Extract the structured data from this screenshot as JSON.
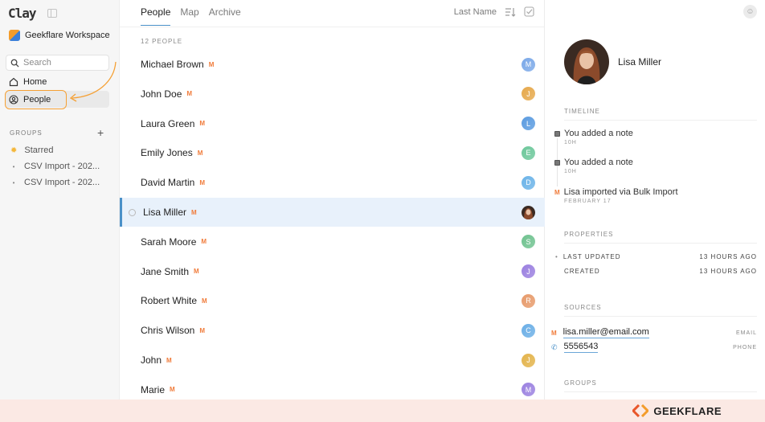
{
  "sidebar": {
    "logo": "Clay",
    "workspace": "Geekflare Workspace",
    "search_placeholder": "Search",
    "nav": {
      "home": "Home",
      "people": "People"
    },
    "groups_header": "GROUPS",
    "groups_add": "+",
    "groups": [
      {
        "label": "Starred"
      },
      {
        "label": "CSV Import - 202..."
      },
      {
        "label": "CSV Import - 202..."
      }
    ]
  },
  "list": {
    "tabs": [
      {
        "label": "People",
        "active": true
      },
      {
        "label": "Map",
        "active": false
      },
      {
        "label": "Archive",
        "active": false
      }
    ],
    "sort_label": "Last Name",
    "count_label": "12 PEOPLE",
    "badge": "M",
    "people": [
      {
        "name": "Michael Brown",
        "initial": "M",
        "selected": false
      },
      {
        "name": "John Doe",
        "initial": "J",
        "selected": false
      },
      {
        "name": "Laura Green",
        "initial": "L",
        "selected": false
      },
      {
        "name": "Emily Jones",
        "initial": "E",
        "selected": false
      },
      {
        "name": "David Martin",
        "initial": "D",
        "selected": false
      },
      {
        "name": "Lisa Miller",
        "initial": "",
        "selected": true
      },
      {
        "name": "Sarah Moore",
        "initial": "S",
        "selected": false
      },
      {
        "name": "Jane Smith",
        "initial": "J",
        "selected": false
      },
      {
        "name": "Robert White",
        "initial": "R",
        "selected": false
      },
      {
        "name": "Chris Wilson",
        "initial": "C",
        "selected": false
      },
      {
        "name": "John",
        "initial": "J",
        "selected": false
      },
      {
        "name": "Marie",
        "initial": "M",
        "selected": false
      }
    ]
  },
  "detail": {
    "name": "Lisa Miller",
    "timeline_header": "TIMELINE",
    "timeline": [
      {
        "text": "You added a note",
        "sub": "10H",
        "icon": "note-icon"
      },
      {
        "text": "You added a note",
        "sub": "10H",
        "icon": "note-icon"
      },
      {
        "text": "Lisa imported via Bulk Import",
        "sub": "FEBRUARY 17",
        "icon": "m-badge"
      }
    ],
    "properties_header": "PROPERTIES",
    "properties": [
      {
        "label": "LAST UPDATED",
        "value": "13 HOURS AGO"
      },
      {
        "label": "CREATED",
        "value": "13 HOURS AGO"
      }
    ],
    "sources_header": "SOURCES",
    "sources": [
      {
        "value": "lisa.miller@email.com",
        "type": "EMAIL"
      },
      {
        "value": "5556543",
        "type": "PHONE"
      }
    ],
    "groups_header": "GROUPS"
  },
  "footer": {
    "brand": "GEEKFLARE"
  },
  "colors": {
    "accent": "#4a90c8",
    "highlight": "#f5a034",
    "badge": "#f07b3a",
    "footer_bg": "#fbe9e4"
  }
}
